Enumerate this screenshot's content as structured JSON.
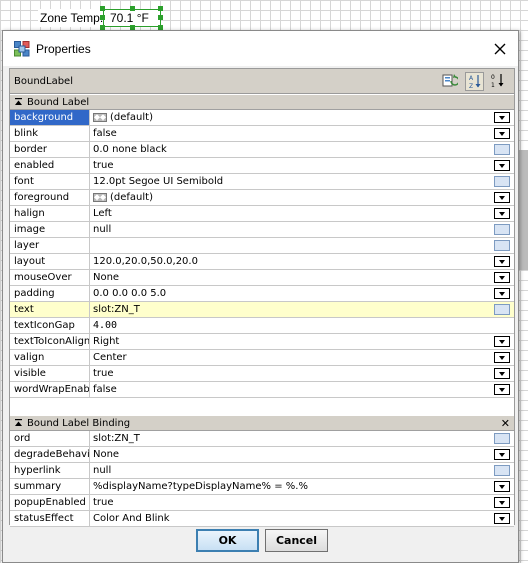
{
  "canvas": {
    "zone_label": "Zone Temp:",
    "zone_value": "70.1 °F"
  },
  "dialog": {
    "title": "Properties",
    "icons": {
      "title": "properties-icon",
      "close": "close-icon"
    },
    "panel_title": "BoundLabel",
    "toolbar_icons": [
      "refresh-icon",
      "sort-alpha-icon",
      "sort-order-icon"
    ],
    "sections": [
      {
        "title": "Bound Label",
        "rows": [
          {
            "name": "background",
            "value": "(default)",
            "swatch": true,
            "control": "dropdown",
            "selected": true
          },
          {
            "name": "blink",
            "value": "false",
            "control": "dropdown"
          },
          {
            "name": "border",
            "value": "0.0 none black",
            "control": "editor"
          },
          {
            "name": "enabled",
            "value": "true",
            "control": "dropdown"
          },
          {
            "name": "font",
            "value": "12.0pt Segoe UI Semibold",
            "control": "editor"
          },
          {
            "name": "foreground",
            "value": "(default)",
            "swatch": true,
            "control": "dropdown"
          },
          {
            "name": "halign",
            "value": "Left",
            "control": "dropdown"
          },
          {
            "name": "image",
            "value": "null",
            "control": "editor"
          },
          {
            "name": "layer",
            "value": "",
            "control": "editor"
          },
          {
            "name": "layout",
            "value": "120.0,20.0,50.0,20.0",
            "control": "dropdown"
          },
          {
            "name": "mouseOver",
            "value": "None",
            "control": "dropdown"
          },
          {
            "name": "padding",
            "value": "0.0 0.0 0.0 5.0",
            "control": "dropdown"
          },
          {
            "name": "text",
            "value": "slot:ZN_T",
            "control": "editor",
            "highlight": true
          },
          {
            "name": "textIconGap",
            "value": "4.00",
            "control": "none",
            "mono": true
          },
          {
            "name": "textToIconAlign",
            "value": "Right",
            "control": "dropdown"
          },
          {
            "name": "valign",
            "value": "Center",
            "control": "dropdown"
          },
          {
            "name": "visible",
            "value": "true",
            "control": "dropdown"
          },
          {
            "name": "wordWrapEnabled",
            "value": "false",
            "control": "dropdown"
          }
        ]
      },
      {
        "title": "Bound Label Binding",
        "closable": true,
        "rows": [
          {
            "name": "ord",
            "value": "slot:ZN_T",
            "control": "editor"
          },
          {
            "name": "degradeBehavior",
            "value": "None",
            "control": "dropdown"
          },
          {
            "name": "hyperlink",
            "value": "null",
            "control": "editor"
          },
          {
            "name": "summary",
            "value": "%displayName?typeDisplayName% = %.%",
            "control": "dropdown"
          },
          {
            "name": "popupEnabled",
            "value": "true",
            "control": "dropdown"
          },
          {
            "name": "statusEffect",
            "value": "Color And Blink",
            "control": "dropdown"
          }
        ]
      }
    ],
    "buttons": {
      "ok": "OK",
      "cancel": "Cancel"
    },
    "colors": {
      "selection": "#3168c8",
      "highlight": "#ffffcc",
      "accent": "#2ca02c"
    }
  }
}
